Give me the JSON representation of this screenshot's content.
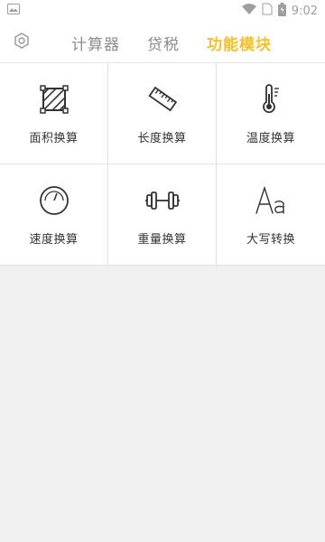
{
  "statusbar": {
    "time": "9:02",
    "icons": [
      "image-icon",
      "wifi-icon",
      "sim-icon",
      "battery-icon"
    ]
  },
  "header": {
    "settings_icon": "hexagon-gear-icon",
    "tabs": [
      {
        "label": "计算器",
        "active": false
      },
      {
        "label": "贷税",
        "active": false
      },
      {
        "label": "功能模块",
        "active": true
      }
    ]
  },
  "modules": [
    {
      "label": "面积换算",
      "icon": "area-icon"
    },
    {
      "label": "长度换算",
      "icon": "ruler-icon"
    },
    {
      "label": "温度换算",
      "icon": "thermometer-icon"
    },
    {
      "label": "速度换算",
      "icon": "speedometer-icon"
    },
    {
      "label": "重量换算",
      "icon": "dumbbell-icon"
    },
    {
      "label": "大写转换",
      "icon": "font-aa-icon"
    }
  ],
  "colors": {
    "accent": "#f6c026",
    "tab_inactive": "#8c8c8c",
    "background": "#f0f0f0",
    "icon": "#333333"
  }
}
